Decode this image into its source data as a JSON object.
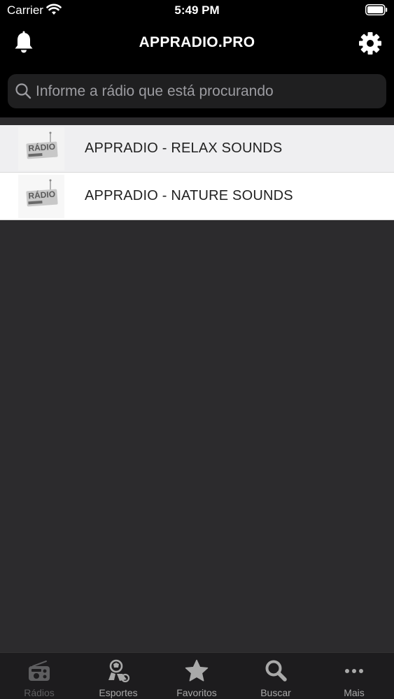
{
  "status_bar": {
    "carrier": "Carrier",
    "time": "5:49 PM"
  },
  "header": {
    "title": "APPRADIO.PRO"
  },
  "search": {
    "placeholder": "Informe a rádio que está procurando"
  },
  "stations": [
    {
      "name": "APPRADIO - RELAX SOUNDS",
      "logo_icon": "radio-app-logo"
    },
    {
      "name": "APPRADIO - NATURE SOUNDS",
      "logo_icon": "radio-app-logo"
    }
  ],
  "logo_text": "RÁDIO",
  "tabs": [
    {
      "label": "Rádios",
      "icon": "radio-icon"
    },
    {
      "label": "Esportes",
      "icon": "sports-icon"
    },
    {
      "label": "Favoritos",
      "icon": "star-icon"
    },
    {
      "label": "Buscar",
      "icon": "search-icon"
    },
    {
      "label": "Mais",
      "icon": "more-icon"
    }
  ],
  "colors": {
    "header_bg": "#000000",
    "content_bg": "#2c2b2d",
    "tab_bar_bg": "#1d1c1e",
    "row_highlight": "#efeff1"
  }
}
